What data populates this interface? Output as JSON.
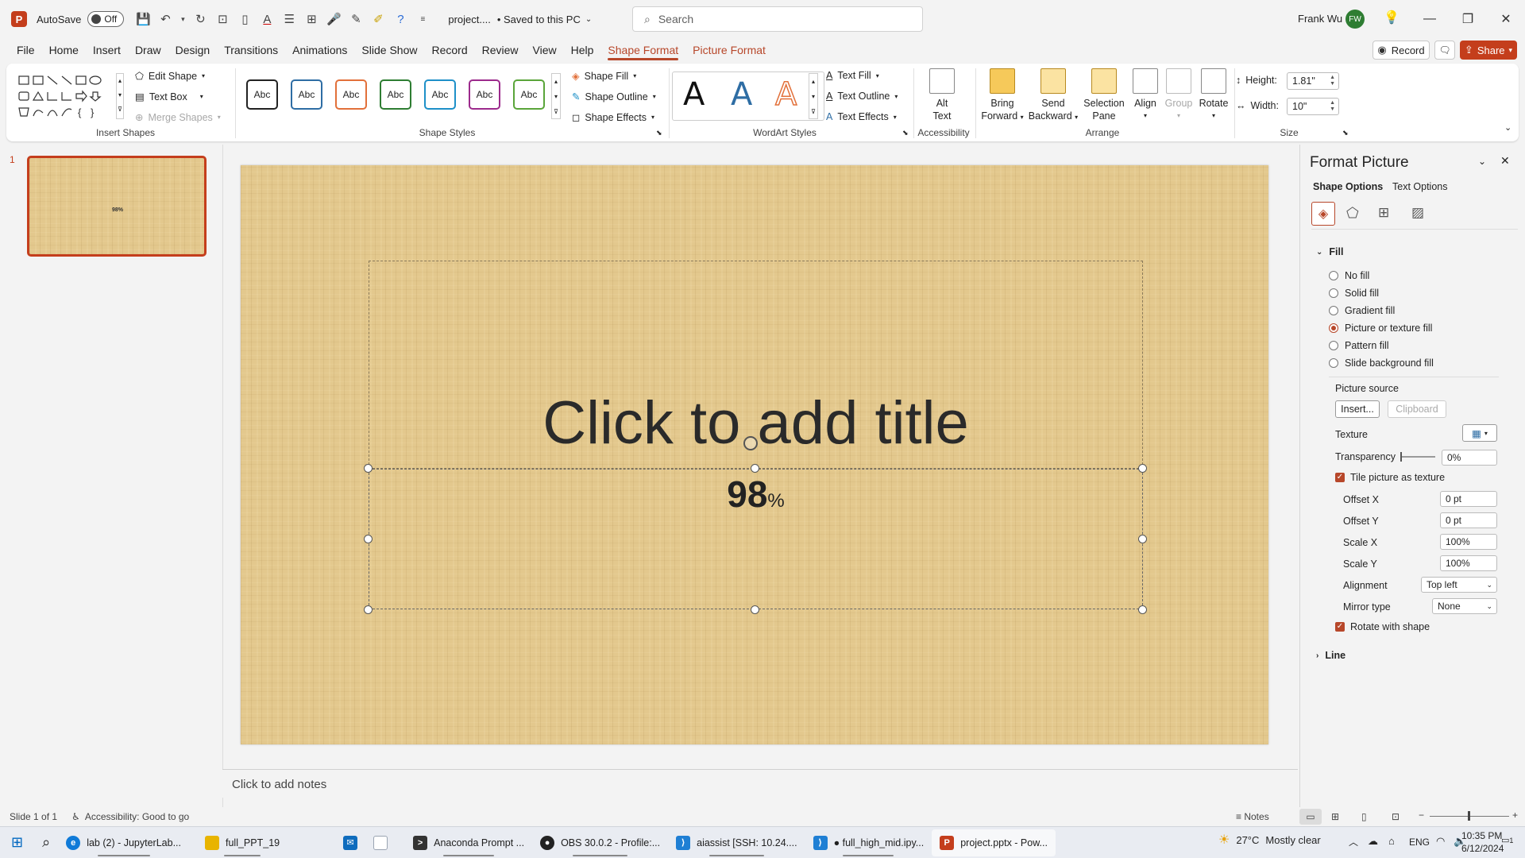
{
  "titlebar": {
    "autosave_label": "AutoSave",
    "autosave_state": "Off",
    "filename": "project....",
    "save_status": "• Saved to this PC",
    "search_placeholder": "Search",
    "user_name": "Frank Wu",
    "user_initials": "FW"
  },
  "menu": {
    "tabs": [
      "File",
      "Home",
      "Insert",
      "Draw",
      "Design",
      "Transitions",
      "Animations",
      "Slide Show",
      "Record",
      "Review",
      "View",
      "Help",
      "Shape Format",
      "Picture Format"
    ],
    "record_label": "Record",
    "share_label": "Share"
  },
  "ribbon": {
    "insert_shapes": {
      "edit_shape": "Edit Shape",
      "text_box": "Text Box",
      "merge_shapes": "Merge Shapes",
      "label": "Insert Shapes"
    },
    "shape_styles": {
      "swatch_text": "Abc",
      "colors": [
        "#222222",
        "#2e6da4",
        "#e2703a",
        "#2e7d32",
        "#1e90c8",
        "#9c2a8c",
        "#5aa53a"
      ],
      "shape_fill": "Shape Fill",
      "shape_outline": "Shape Outline",
      "shape_effects": "Shape Effects",
      "label": "Shape Styles"
    },
    "wordart_styles": {
      "letter": "A",
      "text_fill": "Text Fill",
      "text_outline": "Text Outline",
      "text_effects": "Text Effects",
      "label": "WordArt Styles"
    },
    "accessibility": {
      "alt_text_line1": "Alt",
      "alt_text_line2": "Text",
      "label": "Accessibility"
    },
    "arrange": {
      "bring_forward_1": "Bring",
      "bring_forward_2": "Forward",
      "send_backward_1": "Send",
      "send_backward_2": "Backward",
      "selection_pane_1": "Selection",
      "selection_pane_2": "Pane",
      "align": "Align",
      "group": "Group",
      "rotate": "Rotate",
      "label": "Arrange"
    },
    "size": {
      "height_label": "Height:",
      "height_value": "1.81\"",
      "width_label": "Width:",
      "width_value": "10\"",
      "label": "Size"
    }
  },
  "thumbnails": {
    "slide_number": "1",
    "thumb_text": "98%"
  },
  "slide": {
    "title_placeholder": "Click to add title",
    "body_number": "98",
    "body_suffix": "%"
  },
  "notes_placeholder": "Click to add notes",
  "format_pane": {
    "title": "Format Picture",
    "tab_shape": "Shape Options",
    "tab_text": "Text Options",
    "fill_header": "Fill",
    "fill_options": [
      "No fill",
      "Solid fill",
      "Gradient fill",
      "Picture or texture fill",
      "Pattern fill",
      "Slide background fill"
    ],
    "selected_fill": "Picture or texture fill",
    "picture_source": "Picture source",
    "insert_btn": "Insert...",
    "clipboard_btn": "Clipboard",
    "texture_label": "Texture",
    "transparency_label": "Transparency",
    "transparency_value": "0%",
    "tile_label": "Tile picture as texture",
    "offset_x_label": "Offset X",
    "offset_x_value": "0 pt",
    "offset_y_label": "Offset Y",
    "offset_y_value": "0 pt",
    "scale_x_label": "Scale X",
    "scale_x_value": "100%",
    "scale_y_label": "Scale Y",
    "scale_y_value": "100%",
    "alignment_label": "Alignment",
    "alignment_value": "Top left",
    "mirror_label": "Mirror type",
    "mirror_value": "None",
    "rotate_label": "Rotate with shape",
    "line_header": "Line"
  },
  "status": {
    "slide_info": "Slide 1 of 1",
    "accessibility": "Accessibility: Good to go",
    "notes_label": "Notes"
  },
  "taskbar": {
    "apps": [
      {
        "label": "lab (2) - JupyterLab...",
        "color": "#0f7ad8",
        "glyph": "e"
      },
      {
        "label": "full_PPT_19",
        "color": "#e8b400",
        "glyph": "▬"
      },
      {
        "label": "",
        "color": "#0f6cbd",
        "glyph": "✉"
      },
      {
        "label": "",
        "color": "#9aa4b2",
        "glyph": "▯"
      },
      {
        "label": "Anaconda Prompt ...",
        "color": "#333333",
        "glyph": ">"
      },
      {
        "label": "OBS 30.0.2 - Profile:...",
        "color": "#222222",
        "glyph": "●"
      },
      {
        "label": "aiassist [SSH: 10.24....",
        "color": "#1f7fd4",
        "glyph": "⟩"
      },
      {
        "label": "● full_high_mid.ipy...",
        "color": "#1f7fd4",
        "glyph": "⟩"
      },
      {
        "label": "project.pptx - Pow...",
        "color": "#c43e1c",
        "glyph": "P"
      }
    ],
    "weather_temp": "27°C",
    "weather_text": "Mostly clear",
    "language": "ENG",
    "time": "10:35 PM",
    "date": "6/12/2024",
    "notif_count": "1"
  }
}
